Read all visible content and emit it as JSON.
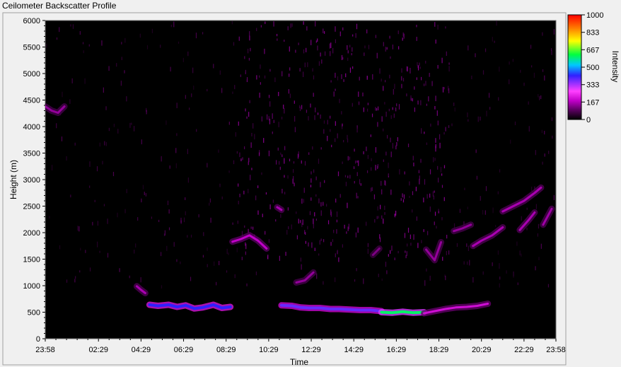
{
  "window": {
    "title": "Ceilometer Backscatter Profile"
  },
  "chart_data": {
    "type": "heatmap",
    "title": "",
    "xlabel": "Time",
    "ylabel": "Height (m)",
    "x_ticks": [
      "23:58",
      "02:29",
      "04:29",
      "06:29",
      "08:29",
      "10:29",
      "12:29",
      "14:29",
      "16:29",
      "18:29",
      "20:29",
      "22:29",
      "23:58"
    ],
    "x_tick_hours": [
      0,
      2.5,
      4.5,
      6.5,
      8.5,
      10.5,
      12.5,
      14.5,
      16.5,
      18.5,
      20.5,
      22.5,
      24
    ],
    "y_ticks": [
      0,
      500,
      1000,
      1500,
      2000,
      2500,
      3000,
      3500,
      4000,
      4500,
      5000,
      5500,
      6000
    ],
    "xlim_hours": [
      0,
      24
    ],
    "ylim": [
      0,
      6000
    ],
    "colorbar": {
      "label": "Intensity",
      "ticks": [
        1000,
        833,
        667,
        500,
        333,
        167,
        0
      ],
      "range": [
        0,
        1000
      ],
      "colors": [
        "#000000",
        "#5a0060",
        "#c000c8",
        "#ff40ff",
        "#3020ff",
        "#00c8ff",
        "#00ff40",
        "#ffff00",
        "#ff8000",
        "#ff0000"
      ]
    },
    "background_noise": {
      "intensity": 50,
      "enhanced_window_hours": [
        9,
        19
      ],
      "enhanced_height_range": [
        1500,
        6000
      ]
    },
    "series": [
      {
        "name": "",
        "x_hours": [
          0.0,
          0.3,
          0.6,
          0.9
        ],
        "y": [
          4380,
          4300,
          4260,
          4380
        ],
        "intensity": 140
      },
      {
        "name": "",
        "x_hours": [
          4.3,
          4.5,
          4.7
        ],
        "y": [
          990,
          920,
          860
        ],
        "intensity": 160
      },
      {
        "name": "",
        "x_hours": [
          4.9,
          5.3,
          5.8,
          6.2,
          6.6,
          7.0,
          7.4,
          7.9,
          8.3,
          8.7
        ],
        "y": [
          640,
          620,
          640,
          600,
          630,
          570,
          590,
          640,
          580,
          600
        ],
        "intensity": 420
      },
      {
        "name": "",
        "x_hours": [
          8.8,
          9.2,
          9.6,
          10.0,
          10.4
        ],
        "y": [
          1830,
          1880,
          1950,
          1850,
          1700
        ],
        "intensity": 180
      },
      {
        "name": "",
        "x_hours": [
          10.9,
          11.1
        ],
        "y": [
          2480,
          2430
        ],
        "intensity": 160
      },
      {
        "name": "",
        "x_hours": [
          11.1,
          11.6,
          12.0,
          12.4,
          12.9,
          13.4,
          13.8,
          14.3,
          14.8,
          15.3,
          15.8
        ],
        "y": [
          630,
          620,
          590,
          580,
          580,
          560,
          560,
          550,
          540,
          540,
          520
        ],
        "intensity": 380
      },
      {
        "name": "",
        "x_hours": [
          11.8,
          12.2,
          12.6
        ],
        "y": [
          1060,
          1100,
          1250
        ],
        "intensity": 140
      },
      {
        "name": "",
        "x_hours": [
          15.8,
          16.3,
          16.8,
          17.3,
          17.8
        ],
        "y": [
          500,
          490,
          510,
          490,
          500
        ],
        "intensity": 600
      },
      {
        "name": "",
        "x_hours": [
          17.8,
          18.3,
          18.8,
          19.3,
          19.8,
          20.3,
          20.8
        ],
        "y": [
          480,
          520,
          560,
          590,
          600,
          620,
          660
        ],
        "intensity": 200
      },
      {
        "name": "",
        "x_hours": [
          15.4,
          15.7
        ],
        "y": [
          1580,
          1700
        ],
        "intensity": 120
      },
      {
        "name": "",
        "x_hours": [
          17.9,
          18.3,
          18.6
        ],
        "y": [
          1680,
          1480,
          1820
        ],
        "intensity": 140
      },
      {
        "name": "",
        "x_hours": [
          19.2,
          19.6,
          20.0
        ],
        "y": [
          2030,
          2080,
          2150
        ],
        "intensity": 140
      },
      {
        "name": "",
        "x_hours": [
          20.1,
          20.5,
          21.0,
          21.5
        ],
        "y": [
          1750,
          1850,
          1950,
          2100
        ],
        "intensity": 160
      },
      {
        "name": "",
        "x_hours": [
          21.5,
          22.0,
          22.5,
          23.0,
          23.3
        ],
        "y": [
          2400,
          2500,
          2600,
          2750,
          2850
        ],
        "intensity": 160
      },
      {
        "name": "",
        "x_hours": [
          22.3,
          22.7,
          23.0
        ],
        "y": [
          2050,
          2230,
          2380
        ],
        "intensity": 160
      },
      {
        "name": "",
        "x_hours": [
          23.4,
          23.8
        ],
        "y": [
          2150,
          2450
        ],
        "intensity": 150
      }
    ]
  }
}
